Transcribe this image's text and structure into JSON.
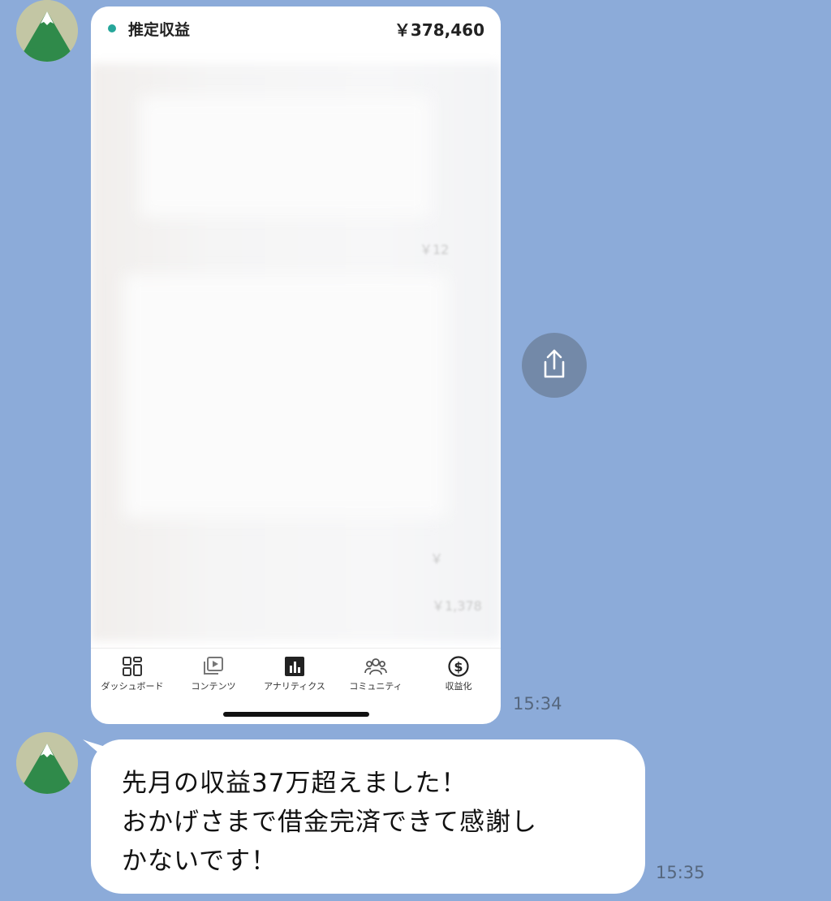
{
  "screenshot_card": {
    "header_label": "推定収益",
    "header_value": "￥378,460",
    "faint_values": [
      "￥12",
      "￥",
      "￥1,378"
    ],
    "accent_color": "#26a69a"
  },
  "bottom_nav": [
    {
      "label": "ダッシュボード",
      "icon": "dashboard-icon",
      "active": false
    },
    {
      "label": "コンテンツ",
      "icon": "content-icon",
      "active": false
    },
    {
      "label": "アナリティクス",
      "icon": "analytics-icon",
      "active": true
    },
    {
      "label": "コミュニティ",
      "icon": "community-icon",
      "active": false
    },
    {
      "label": "収益化",
      "icon": "monetization-icon",
      "active": false
    }
  ],
  "share_button": {
    "icon": "share-icon"
  },
  "messages": [
    {
      "time": "15:34"
    },
    {
      "lines": [
        "先月の収益37万超えました！",
        "おかげさまで借金完済できて感謝し",
        "かないです！"
      ],
      "time": "15:35"
    }
  ],
  "avatar": {
    "icon": "mountain-avatar-icon"
  },
  "colors": {
    "chat_background": "#8cabd9",
    "bubble": "#ffffff",
    "time_text": "#56677e"
  }
}
